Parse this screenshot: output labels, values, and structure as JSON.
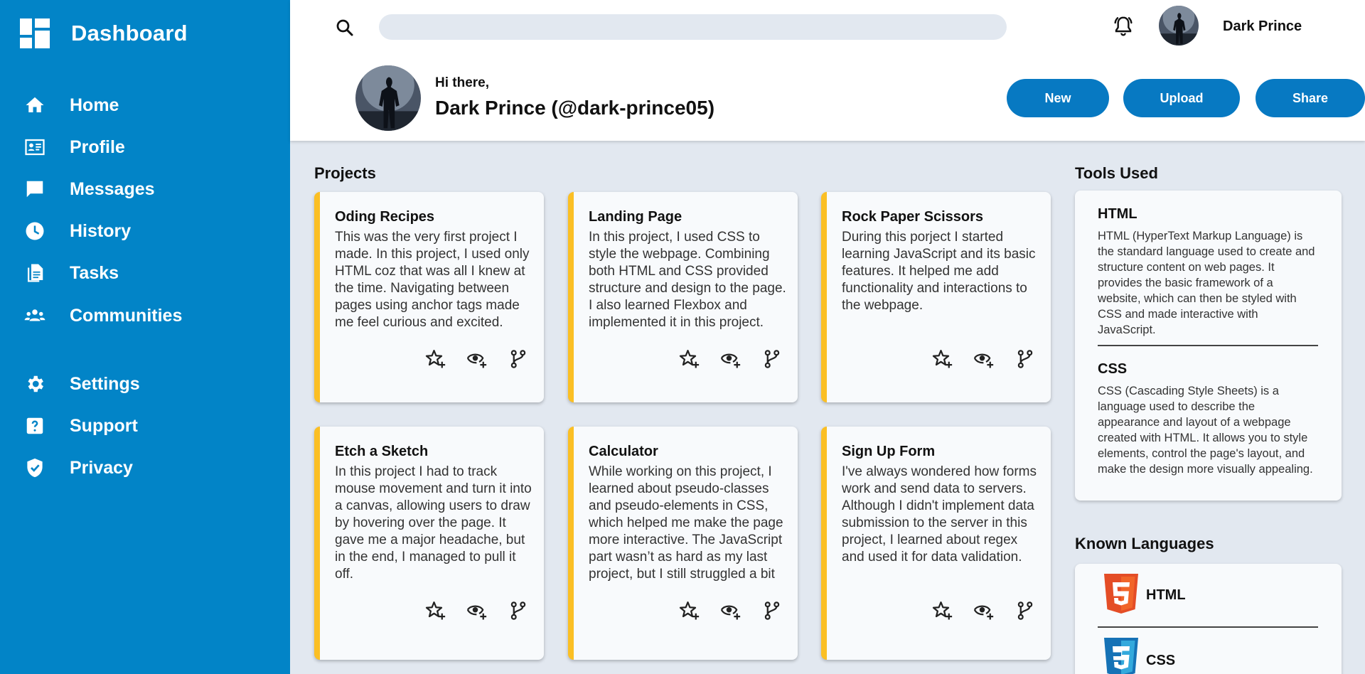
{
  "sidebar": {
    "title": "Dashboard",
    "items": [
      {
        "label": "Home",
        "icon": "home-icon"
      },
      {
        "label": "Profile",
        "icon": "id-card-icon"
      },
      {
        "label": "Messages",
        "icon": "message-icon"
      },
      {
        "label": "History",
        "icon": "clock-icon"
      },
      {
        "label": "Tasks",
        "icon": "file-icon"
      },
      {
        "label": "Communities",
        "icon": "people-icon"
      },
      {
        "label": "Settings",
        "icon": "gear-icon"
      },
      {
        "label": "Support",
        "icon": "help-icon"
      },
      {
        "label": "Privacy",
        "icon": "shield-icon"
      }
    ]
  },
  "header": {
    "search_placeholder": "",
    "username": "Dark Prince",
    "greeting": "Hi there,",
    "full_name": "Dark Prince (@dark-prince05)",
    "buttons": {
      "new": "New",
      "upload": "Upload",
      "share": "Share"
    }
  },
  "projects": {
    "title": "Projects",
    "items": [
      {
        "title": "Oding Recipes",
        "description": "This was the very first project I made. In this project, I used only HTML coz that was all I knew at the time. Navigating between pages using anchor tags made me feel curious and excited."
      },
      {
        "title": "Landing Page",
        "description": "In this project, I used CSS to style the webpage. Combining both HTML and CSS provided structure and design to the page. I also learned Flexbox and implemented it in this project."
      },
      {
        "title": "Rock Paper Scissors",
        "description": "During this porject I started learning JavaScript and its basic features. It helped me add functionality and interactions to the webpage."
      },
      {
        "title": "Etch a Sketch",
        "description": "In this project I had to track mouse movement and turn it into a canvas, allowing users to draw by hovering over the page. It gave me a major headache, but in the end, I managed to pull it off."
      },
      {
        "title": "Calculator",
        "description": "While working on this project, I learned about pseudo-classes and pseudo-elements in CSS, which helped me make the page more interactive. The JavaScript part wasn’t as hard as my last project, but I still struggled a bit"
      },
      {
        "title": "Sign Up Form",
        "description": "I've always wondered how forms work and send data to servers. Although I didn't implement data submission to the server in this project, I learned about regex and used it for data validation."
      }
    ]
  },
  "tools": {
    "title": "Tools Used",
    "items": [
      {
        "name": "HTML",
        "description": "HTML (HyperText Markup Language) is the standard language used to create and structure content on web pages. It provides the basic framework of a website, which can then be styled with CSS and made interactive with JavaScript."
      },
      {
        "name": "CSS",
        "description": "CSS (Cascading Style Sheets) is a language used to describe the appearance and layout of a webpage created with HTML. It allows you to style elements, control the page's layout, and make the design more visually appealing."
      }
    ]
  },
  "languages": {
    "title": "Known Languages",
    "items": [
      {
        "name": "HTML",
        "icon": "html5-icon",
        "color": "#e44d26"
      },
      {
        "name": "CSS",
        "icon": "css3-icon",
        "color": "#1572b6"
      }
    ]
  },
  "colors": {
    "sidebar": "#0284c7",
    "button": "#0779c2",
    "card_accent": "#fbbf24",
    "background": "#e2e8f0"
  }
}
